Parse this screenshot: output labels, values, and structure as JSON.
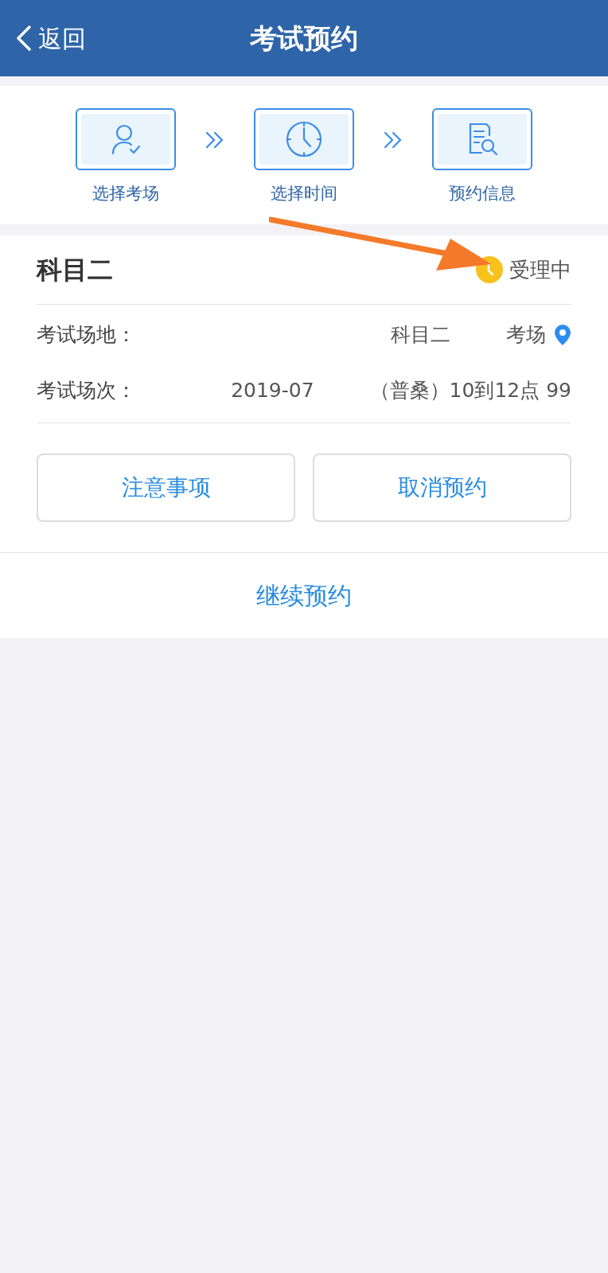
{
  "header": {
    "back": "返回",
    "title": "考试预约"
  },
  "steps": [
    {
      "kind": "user",
      "label": "选择考场"
    },
    {
      "kind": "clock",
      "label": "选择时间"
    },
    {
      "kind": "doc",
      "label": "预约信息"
    }
  ],
  "card": {
    "subject": "科目二",
    "status": "受理中",
    "rows": [
      {
        "label": "考试场地：",
        "value_parts": [
          "科目二",
          "考场"
        ],
        "location": true
      },
      {
        "label": "考试场次：",
        "value_parts": [
          "2019-07",
          "（普桑）10到12点 99"
        ],
        "location": false
      }
    ],
    "buttons": [
      "注意事项",
      "取消预约"
    ]
  },
  "continue": "继续预约"
}
